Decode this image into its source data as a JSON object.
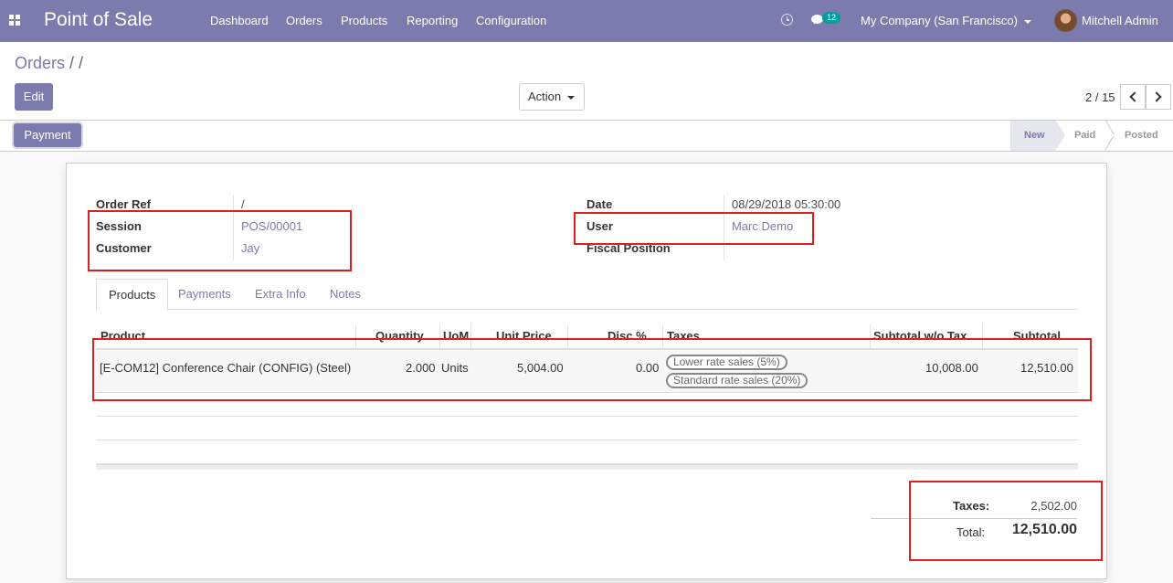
{
  "navbar": {
    "app_title": "Point of Sale",
    "menu": [
      "Dashboard",
      "Orders",
      "Products",
      "Reporting",
      "Configuration"
    ],
    "messages_count": "12",
    "company": "My Company (San Francisco)",
    "user": "Mitchell Admin"
  },
  "breadcrumb": {
    "root": "Orders",
    "current": "/"
  },
  "buttons": {
    "edit": "Edit",
    "action": "Action",
    "payment": "Payment"
  },
  "pager": {
    "value": "2 / 15"
  },
  "status_stages": [
    "New",
    "Paid",
    "Posted"
  ],
  "fields": {
    "order_ref_label": "Order Ref",
    "order_ref": "/",
    "session_label": "Session",
    "session": "POS/00001",
    "customer_label": "Customer",
    "customer": "Jay",
    "date_label": "Date",
    "date": "08/29/2018 05:30:00",
    "user_label": "User",
    "user": "Marc Demo",
    "fiscal_position_label": "Fiscal Position",
    "fiscal_position": ""
  },
  "tabs": [
    "Products",
    "Payments",
    "Extra Info",
    "Notes"
  ],
  "table": {
    "columns": [
      "Product",
      "Quantity",
      "UoM",
      "Unit Price",
      "Disc.%",
      "Taxes",
      "Subtotal w/o Tax",
      "Subtotal"
    ],
    "rows": [
      {
        "product": "[E-COM12] Conference Chair (CONFIG) (Steel)",
        "quantity": "2.000",
        "uom": "Units",
        "unit_price": "5,004.00",
        "discount": "0.00",
        "taxes": [
          "Lower rate sales (5%)",
          "Standard rate sales (20%)"
        ],
        "subtotal_wo_tax": "10,008.00",
        "subtotal": "12,510.00"
      }
    ]
  },
  "totals": {
    "taxes_label": "Taxes:",
    "taxes": "2,502.00",
    "total_label": "Total:",
    "total": "12,510.00"
  },
  "colors": {
    "brand": "#7c7bad",
    "highlight": "#e02020"
  }
}
